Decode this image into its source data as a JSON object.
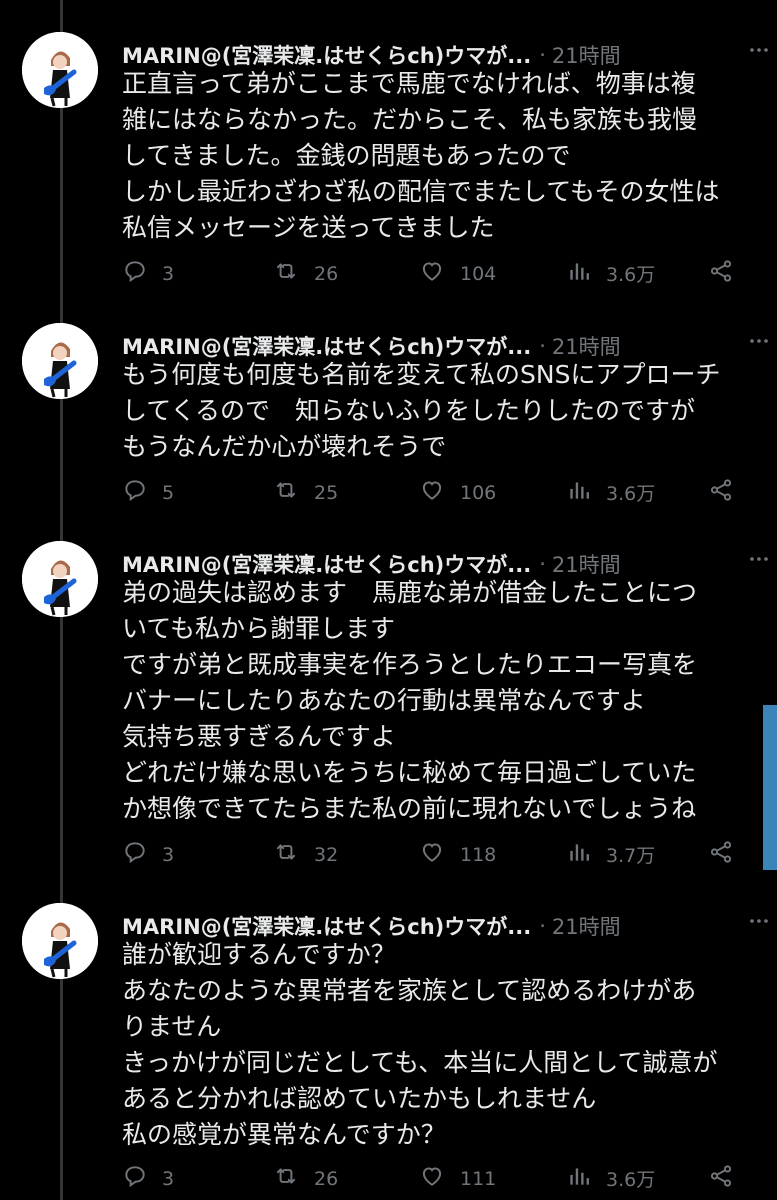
{
  "tweets": [
    {
      "name": "MARIN@(宮澤茉凜.はせくらch)ウマが...",
      "sep": "·",
      "time": "21時間",
      "lines": [
        "正直言って弟がここまで馬鹿でなければ、物事は複",
        "雑にはならなかった。だからこそ、私も家族も我慢",
        "してきました。金銭の問題もあったので",
        "しかし最近わざわざ私の配信でまたしてもその女性は",
        "私信メッセージを送ってきました"
      ],
      "replies": "3",
      "retweets": "26",
      "likes": "104",
      "views": "3.6万"
    },
    {
      "name": "MARIN@(宮澤茉凜.はせくらch)ウマが...",
      "sep": "·",
      "time": "21時間",
      "lines": [
        "もう何度も何度も名前を変えて私のSNSにアプローチ",
        "してくるので　知らないふりをしたりしたのですが",
        "もうなんだか心が壊れそうで"
      ],
      "replies": "5",
      "retweets": "25",
      "likes": "106",
      "views": "3.6万"
    },
    {
      "name": "MARIN@(宮澤茉凜.はせくらch)ウマが...",
      "sep": "·",
      "time": "21時間",
      "lines": [
        "弟の過失は認めます　馬鹿な弟が借金したことにつ",
        "いても私から謝罪します",
        "ですが弟と既成事実を作ろうとしたりエコー写真を",
        "バナーにしたりあなたの行動は異常なんですよ",
        "気持ち悪すぎるんですよ",
        "どれだけ嫌な思いをうちに秘めて毎日過ごしていた",
        "か想像できてたらまた私の前に現れないでしょうね"
      ],
      "replies": "3",
      "retweets": "32",
      "likes": "118",
      "views": "3.7万"
    },
    {
      "name": "MARIN@(宮澤茉凜.はせくらch)ウマが...",
      "sep": "·",
      "time": "21時間",
      "lines": [
        "誰が歓迎するんですか？",
        "あなたのような異常者を家族として認めるわけがあ",
        "りません",
        "きっかけが同じだとしても、本当に人間として誠意が",
        "あると分かれば認めていたかもしれません",
        "私の感覚が異常なんですか？"
      ],
      "replies": "3",
      "retweets": "26",
      "likes": "111",
      "views": "3.6万"
    }
  ],
  "icons": {
    "avatar": "avatar-image",
    "more": "more-dots-icon",
    "reply": "reply-icon",
    "retweet": "retweet-icon",
    "like": "heart-icon",
    "views": "views-chart-icon",
    "share": "share-icon"
  },
  "colors": {
    "background": "#000000",
    "text": "#e7e9ea",
    "muted": "#71767b",
    "thread_line": "#333639",
    "scroll_indicator": "#3a84b8"
  }
}
